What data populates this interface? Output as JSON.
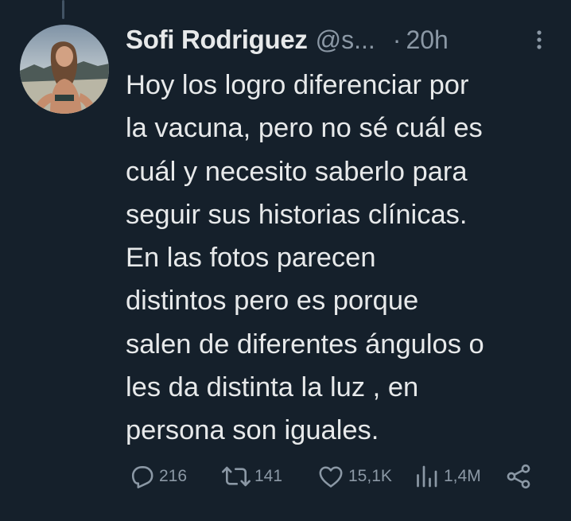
{
  "tweet": {
    "display_name": "Sofi Rodriguez",
    "handle": "@s...",
    "separator": "·",
    "time": "20h",
    "text_lines": [
      "Hoy los logro diferenciar por",
      "la vacuna, pero no sé cuál es",
      "cuál y necesito saberlo para",
      "seguir sus historias clínicas.",
      "En las fotos parecen",
      "distintos pero es porque",
      "salen de diferentes ángulos o",
      "les da distinta la luz , en",
      "persona son iguales."
    ]
  },
  "actions": {
    "replies": "216",
    "retweets": "141",
    "likes": "15,1K",
    "views": "1,4M"
  },
  "icons": {
    "avatar": "avatar-photo",
    "more": "more-vertical-icon",
    "reply": "reply-icon",
    "retweet": "retweet-icon",
    "like": "heart-icon",
    "views": "views-icon",
    "share": "share-icon"
  },
  "colors": {
    "background": "#15202b",
    "text_primary": "#e7e9ea",
    "text_secondary": "#8b98a5"
  }
}
